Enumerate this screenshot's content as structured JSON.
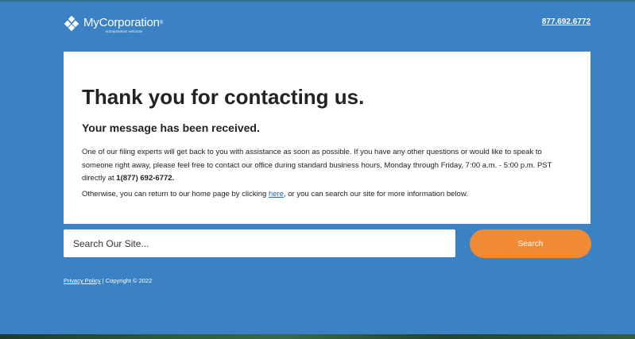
{
  "header": {
    "logo_name": "MyCorporation",
    "logo_reg": "®",
    "logo_tagline": "entrepreneurs welcome",
    "phone": "877.692.6772"
  },
  "card": {
    "title": "Thank you for contacting us.",
    "subtitle": "Your message has been received.",
    "paragraph1_text": "One of our filing experts will get back to you with assistance as soon as possible. If you have any other questions or would like to speak to someone right away, please feel free to contact our office during standard business hours, Monday through Friday, 7:00 a.m. - 5:00 p.m. PST directly at ",
    "paragraph1_phone": "1(877) 692-6772.",
    "paragraph2_before": "Otherwise, you can return to our home page by clicking ",
    "paragraph2_link": "here",
    "paragraph2_after": ", or you can search our site for more information below."
  },
  "search": {
    "placeholder": "Search Our Site...",
    "button_label": "Search"
  },
  "footer": {
    "privacy_link": "Privacy Policy",
    "copyright": " | Copyright © 2022"
  },
  "colors": {
    "background": "#3b82c4",
    "accent": "#f08a33",
    "card": "#ffffff"
  },
  "icons": {
    "logo": "diamond-logo-icon"
  }
}
